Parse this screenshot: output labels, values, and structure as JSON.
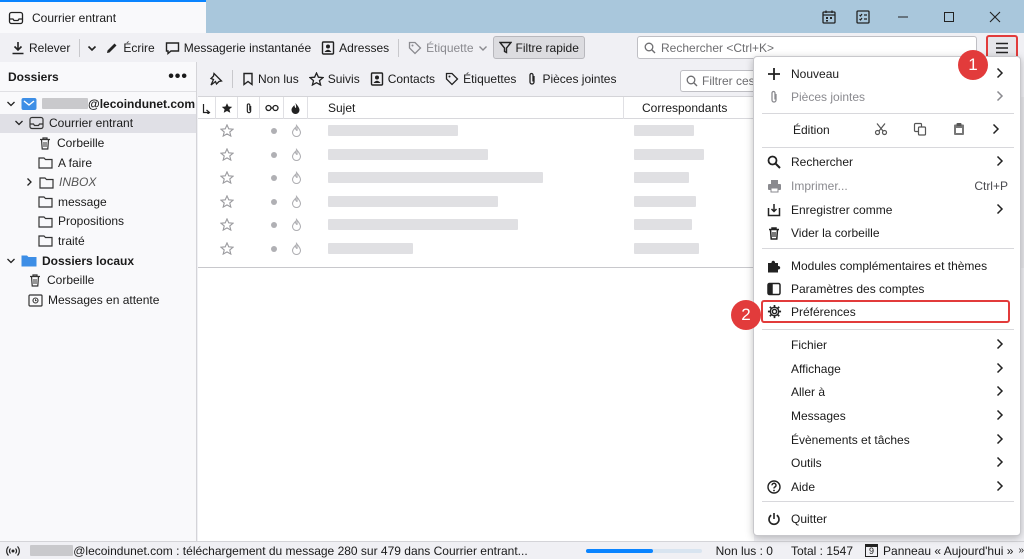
{
  "tab": {
    "title": "Courrier entrant"
  },
  "toolbar": {
    "relever": "Relever",
    "ecrire": "Écrire",
    "messagerie": "Messagerie instantanée",
    "adresses": "Adresses",
    "etiquette": "Étiquette",
    "filtre_rapide": "Filtre rapide",
    "search_placeholder": "Rechercher <Ctrl+K>"
  },
  "folders": {
    "header": "Dossiers",
    "account_suffix": "@lecoindunet.com",
    "items": [
      {
        "label": "Courrier entrant"
      },
      {
        "label": "Corbeille"
      },
      {
        "label": "A faire"
      },
      {
        "label": "INBOX"
      },
      {
        "label": "message"
      },
      {
        "label": "Propositions"
      },
      {
        "label": "traité"
      }
    ],
    "local": "Dossiers locaux",
    "local_items": [
      {
        "label": "Corbeille"
      },
      {
        "label": "Messages en attente"
      }
    ]
  },
  "quickfilter": {
    "non_lus": "Non lus",
    "suivis": "Suivis",
    "contacts": "Contacts",
    "etiquettes": "Étiquettes",
    "pieces_jointes": "Pièces jointes",
    "filter_placeholder": "Filtrer ces messages"
  },
  "columns": {
    "sujet": "Sujet",
    "correspondants": "Correspondants"
  },
  "menu": {
    "nouveau": "Nouveau",
    "pieces_jointes": "Pièces jointes",
    "edition": "Édition",
    "rechercher": "Rechercher",
    "imprimer": "Imprimer...",
    "imprimer_shortcut": "Ctrl+P",
    "enregistrer": "Enregistrer comme",
    "vider": "Vider la corbeille",
    "modules": "Modules complémentaires et thèmes",
    "parametres": "Paramètres des comptes",
    "preferences": "Préférences",
    "fichier": "Fichier",
    "affichage": "Affichage",
    "aller": "Aller à",
    "messages": "Messages",
    "evenements": "Évènements et tâches",
    "outils": "Outils",
    "aide": "Aide",
    "quitter": "Quitter"
  },
  "badges": {
    "one": "1",
    "two": "2"
  },
  "status": {
    "message": "@lecoindunet.com : téléchargement du message 280 sur 479 dans Courrier entrant...",
    "progress": 0.58,
    "non_lus": "Non lus : 0",
    "total": "Total : 1547",
    "panneau": "Panneau « Aujourd'hui »",
    "calendar_day": "9"
  },
  "colors": {
    "accent": "#0a84ff",
    "highlight": "#e23b3b",
    "titlebar": "#a9c7dc"
  }
}
